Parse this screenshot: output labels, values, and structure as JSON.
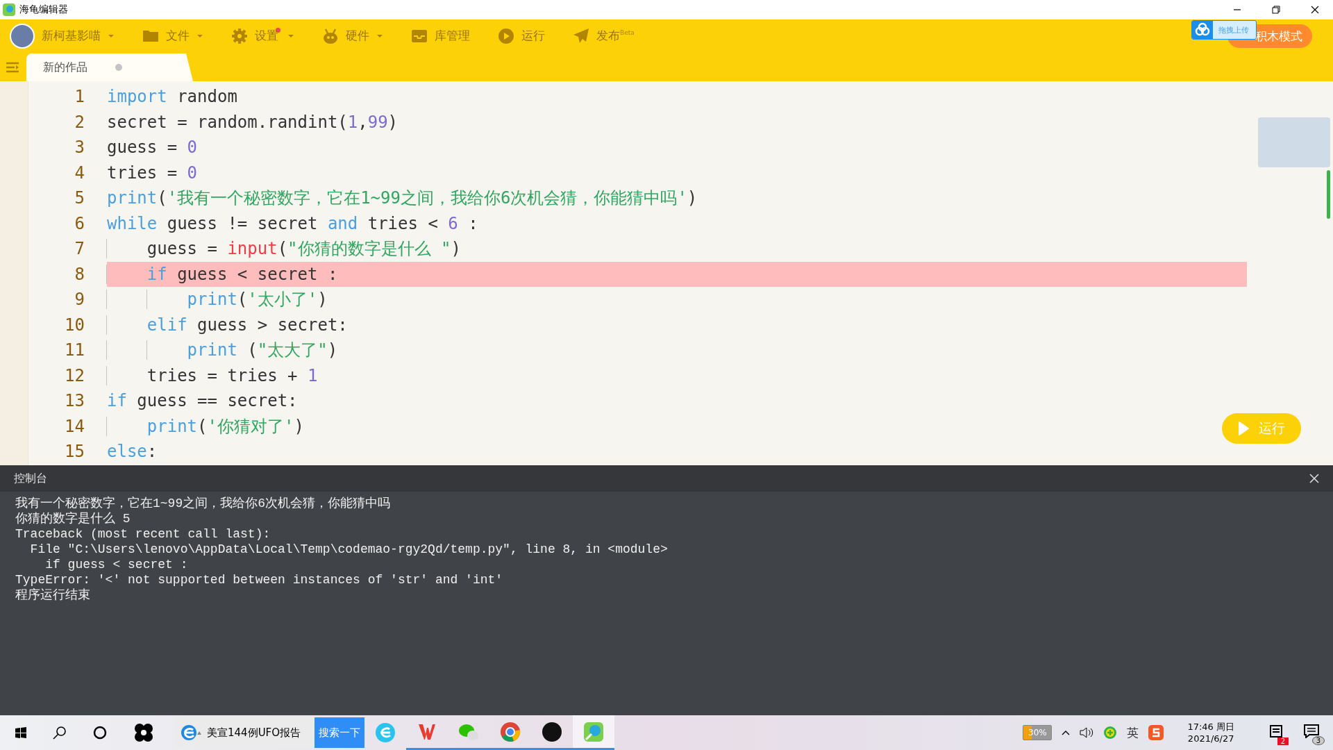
{
  "window": {
    "title": "海龟编辑器"
  },
  "toolbar": {
    "user": {
      "name": "新柯基影喵",
      "dropdown": true
    },
    "menus": [
      {
        "kind": "folder",
        "label": "文件",
        "dropdown": true,
        "badge": false
      },
      {
        "kind": "gear",
        "label": "设置",
        "dropdown": true,
        "badge": true
      },
      {
        "kind": "robot",
        "label": "硬件",
        "dropdown": true,
        "badge": false
      },
      {
        "kind": "box",
        "label": "库管理",
        "dropdown": false,
        "badge": false
      },
      {
        "kind": "play",
        "label": "运行",
        "dropdown": false,
        "badge": false
      },
      {
        "kind": "plane",
        "label": "发布$^{Beta}$",
        "dropdown": false,
        "badge": false
      }
    ],
    "upload_widget": {
      "label": "拖拽上传"
    },
    "mode_button": {
      "label": "积木模式"
    }
  },
  "tabs": [
    {
      "label": "新的作品",
      "selected": true,
      "unsaved": true
    }
  ],
  "editor": {
    "lines": [
      {
        "number": "1",
        "highlighted": false,
        "tokens": [
          {
            "kind": "keyword",
            "text": "import"
          },
          {
            "kind": "plain",
            "text": " random"
          }
        ]
      },
      {
        "number": "2",
        "highlighted": false,
        "tokens": [
          {
            "kind": "plain",
            "text": "secret = random.randint("
          },
          {
            "kind": "number",
            "text": "1"
          },
          {
            "kind": "plain",
            "text": ","
          },
          {
            "kind": "number",
            "text": "99"
          },
          {
            "kind": "plain",
            "text": ")"
          }
        ]
      },
      {
        "number": "3",
        "highlighted": false,
        "tokens": [
          {
            "kind": "plain",
            "text": "guess = "
          },
          {
            "kind": "number",
            "text": "0"
          }
        ]
      },
      {
        "number": "4",
        "highlighted": false,
        "tokens": [
          {
            "kind": "plain",
            "text": "tries = "
          },
          {
            "kind": "number",
            "text": "0"
          }
        ]
      },
      {
        "number": "5",
        "highlighted": false,
        "tokens": [
          {
            "kind": "keyword",
            "text": "print"
          },
          {
            "kind": "plain",
            "text": "("
          },
          {
            "kind": "string",
            "text": "'我有一个秘密数字，它在1~99之间，我给你6次机会猜，你能猜中吗'"
          },
          {
            "kind": "plain",
            "text": ")"
          }
        ]
      },
      {
        "number": "6",
        "highlighted": false,
        "tokens": [
          {
            "kind": "keyword",
            "text": "while"
          },
          {
            "kind": "plain",
            "text": " guess != secret "
          },
          {
            "kind": "keyword",
            "text": "and"
          },
          {
            "kind": "plain",
            "text": " tries < "
          },
          {
            "kind": "number",
            "text": "6"
          },
          {
            "kind": "plain",
            "text": " :"
          }
        ]
      },
      {
        "number": "7",
        "highlighted": false,
        "tokens": [
          {
            "kind": "plain",
            "text": "    guess = "
          },
          {
            "kind": "special",
            "text": "input"
          },
          {
            "kind": "plain",
            "text": "("
          },
          {
            "kind": "string",
            "text": "\"你猜的数字是什么 \""
          },
          {
            "kind": "plain",
            "text": ")"
          }
        ]
      },
      {
        "number": "8",
        "highlighted": true,
        "tokens": [
          {
            "kind": "keyword",
            "text": "    if"
          },
          {
            "kind": "plain",
            "text": " guess < secret :"
          }
        ]
      },
      {
        "number": "9",
        "highlighted": false,
        "tokens": [
          {
            "kind": "keyword",
            "text": "        print"
          },
          {
            "kind": "plain",
            "text": "("
          },
          {
            "kind": "string",
            "text": "'太小了'"
          },
          {
            "kind": "plain",
            "text": ")"
          }
        ]
      },
      {
        "number": "10",
        "highlighted": false,
        "tokens": [
          {
            "kind": "keyword",
            "text": "    elif"
          },
          {
            "kind": "plain",
            "text": " guess > secret:"
          }
        ]
      },
      {
        "number": "11",
        "highlighted": false,
        "tokens": [
          {
            "kind": "keyword",
            "text": "        print"
          },
          {
            "kind": "plain",
            "text": " ("
          },
          {
            "kind": "string",
            "text": "\"太大了\""
          },
          {
            "kind": "plain",
            "text": ")"
          }
        ]
      },
      {
        "number": "12",
        "highlighted": false,
        "tokens": [
          {
            "kind": "plain",
            "text": "    tries = tries + "
          },
          {
            "kind": "number",
            "text": "1"
          }
        ]
      },
      {
        "number": "13",
        "highlighted": false,
        "tokens": [
          {
            "kind": "keyword",
            "text": "if"
          },
          {
            "kind": "plain",
            "text": " guess == secret:"
          }
        ]
      },
      {
        "number": "14",
        "highlighted": false,
        "tokens": [
          {
            "kind": "keyword",
            "text": "    print"
          },
          {
            "kind": "plain",
            "text": "("
          },
          {
            "kind": "string",
            "text": "'你猜对了'"
          },
          {
            "kind": "plain",
            "text": ")"
          }
        ]
      },
      {
        "number": "15",
        "highlighted": false,
        "tokens": [
          {
            "kind": "keyword",
            "text": "else"
          },
          {
            "kind": "plain",
            "text": ":"
          }
        ]
      }
    ],
    "run_button": {
      "label": "运行"
    }
  },
  "console": {
    "title": "控制台",
    "output": [
      "我有一个秘密数字，它在1~99之间，我给你6次机会猜，你能猜中吗",
      "你猜的数字是什么 5",
      "Traceback (most recent call last):",
      "  File \"C:\\Users\\lenovo\\AppData\\Local\\Temp\\codemao-rgy2Qd/temp.py\", line 8, in <module>",
      "    if guess < secret :",
      "TypeError: '<' not supported between instances of 'str' and 'int'",
      "程序运行结束"
    ]
  },
  "taskbar": {
    "search": {
      "value": "美宣144例UFO报告",
      "button": "搜索一下"
    },
    "apps": [
      {
        "kind": "browser-e",
        "running": false
      },
      {
        "kind": "wps",
        "running": true
      },
      {
        "kind": "chat",
        "running": true
      },
      {
        "kind": "chrome",
        "running": true
      },
      {
        "kind": "dark",
        "running": true
      },
      {
        "kind": "turtle",
        "running": true,
        "selected": true
      }
    ],
    "tray": {
      "battery": "30%",
      "input_method": "英",
      "time": "17:46 周日",
      "date": "2021/6/27",
      "notes_badge": "2",
      "actions_badge": "3"
    }
  }
}
